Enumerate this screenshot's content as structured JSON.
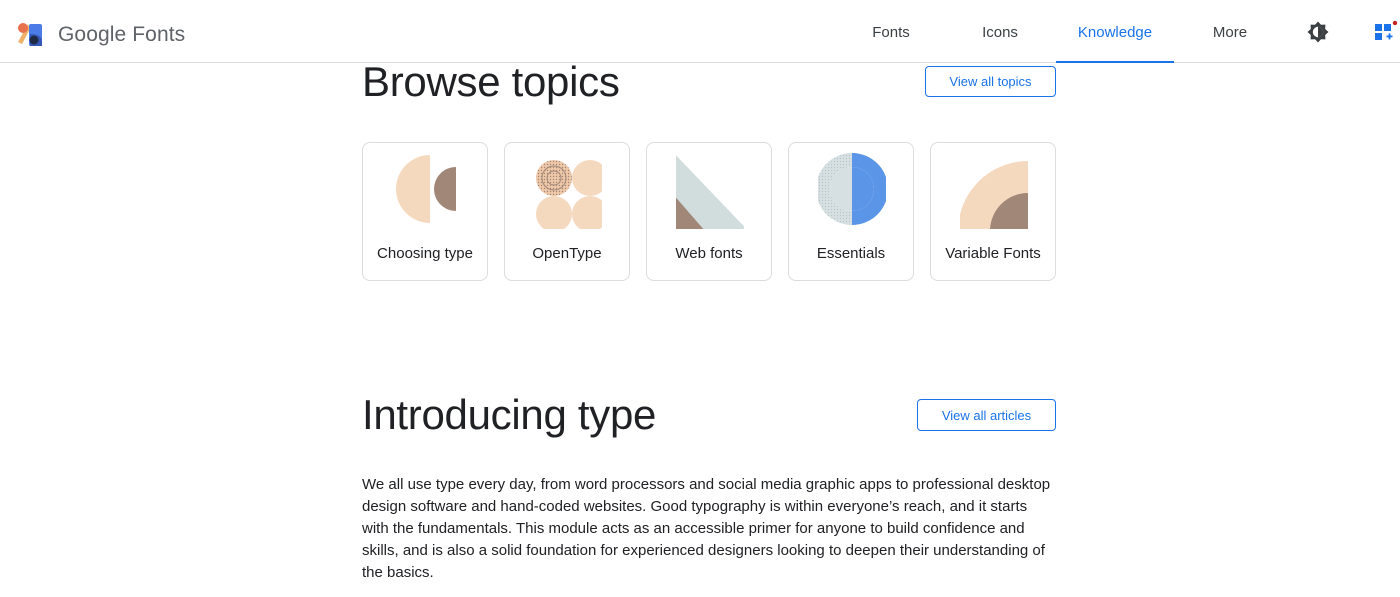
{
  "header": {
    "brand_name": "Google Fonts",
    "logo_icon": "google-fonts-logo",
    "nav": [
      "Fonts",
      "Icons",
      "Knowledge",
      "More"
    ],
    "active_nav": "Knowledge",
    "theme_icon": "brightness-icon",
    "selection_icon": "font-selection-grid-icon"
  },
  "browse": {
    "title": "Browse topics",
    "view_all": "View all topics",
    "topics": [
      {
        "label": "Choosing type",
        "art": "choosing-type-art"
      },
      {
        "label": "OpenType",
        "art": "opentype-art"
      },
      {
        "label": "Web fonts",
        "art": "web-fonts-art"
      },
      {
        "label": "Essentials",
        "art": "essentials-art"
      },
      {
        "label": "Variable Fonts",
        "art": "variable-fonts-art"
      }
    ]
  },
  "intro": {
    "title": "Introducing type",
    "view_all": "View all articles",
    "body": "We all use type every day, from word processors and social media graphic apps to professional desktop design software and hand-coded websites. Good typography is within everyone’s reach, and it starts with the fundamentals. This module acts as an accessible primer for anyone to build confidence and skills, and is also a solid foundation for experienced designers looking to deepen their understanding of the basics."
  },
  "colors": {
    "accent": "#1a73e8",
    "peach": "#f5d9bf",
    "taupe": "#a08778",
    "sage": "#d1dcdc",
    "blue": "#5b95e8"
  }
}
